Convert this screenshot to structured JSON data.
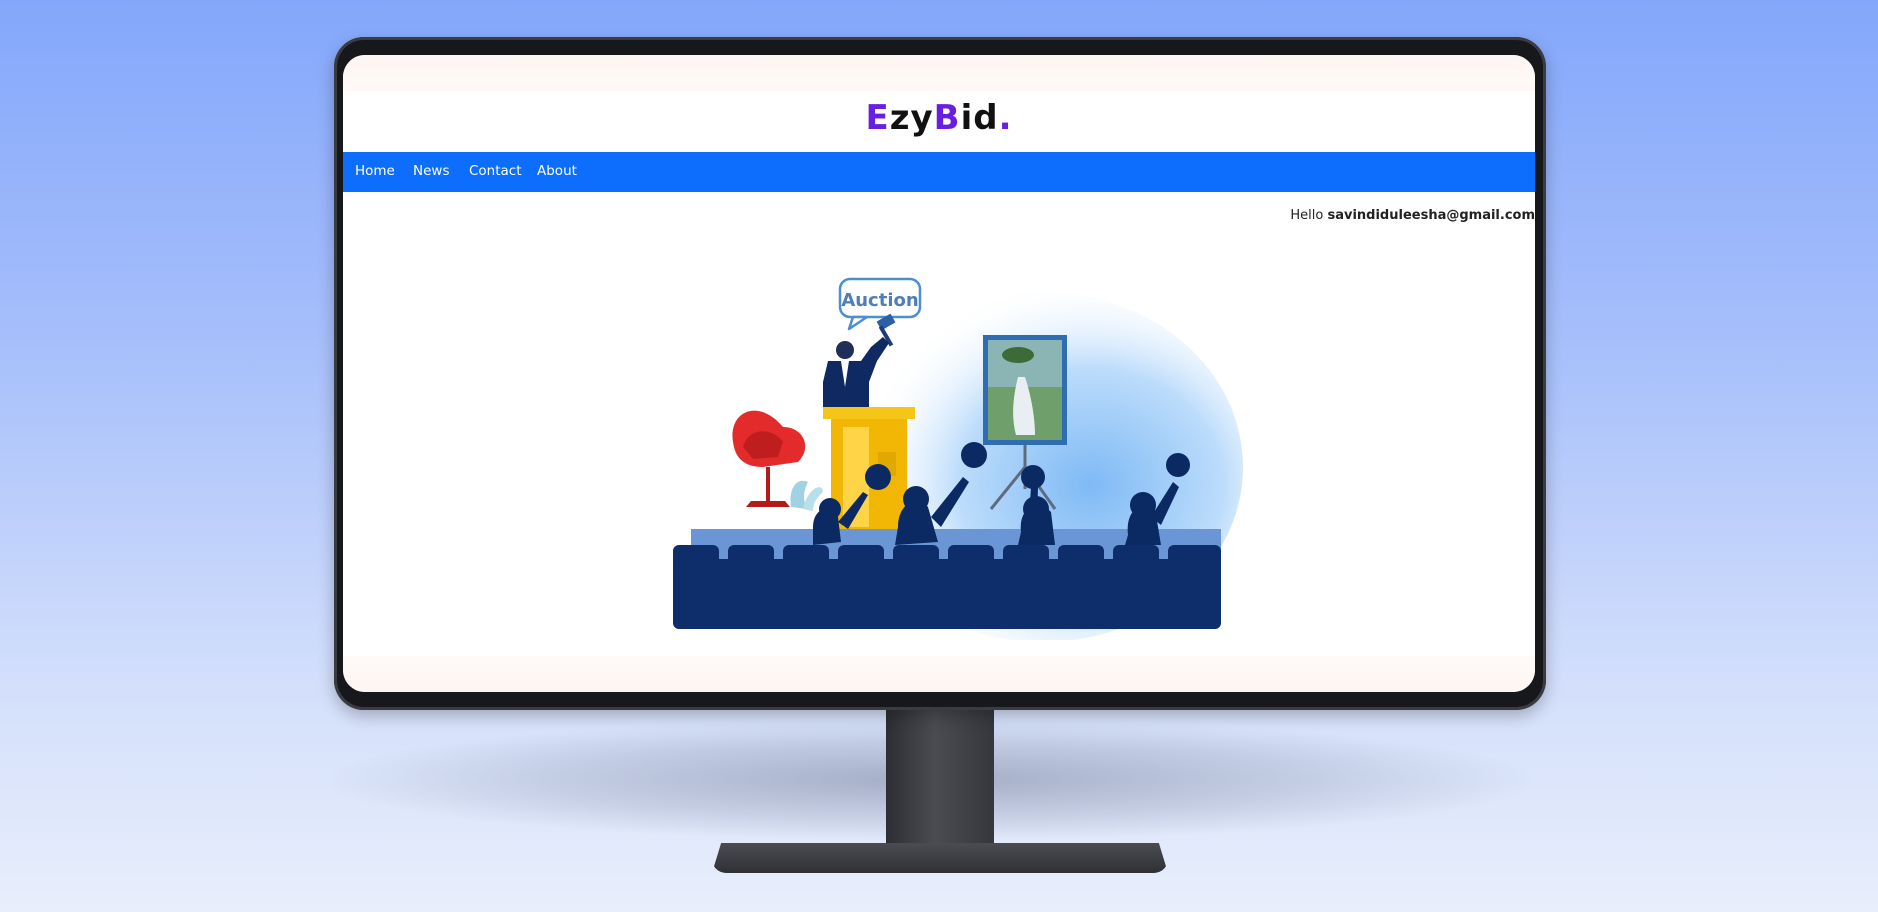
{
  "brand": {
    "logo_e": "E",
    "logo_zy": "zy",
    "logo_b": "B",
    "logo_id": "id",
    "logo_dot": ".",
    "accent_color": "#6a1fe0"
  },
  "nav": {
    "items": [
      {
        "label": "Home"
      },
      {
        "label": "News"
      },
      {
        "label": "Contact"
      },
      {
        "label": "About"
      }
    ],
    "bar_color": "#0d6efd"
  },
  "user": {
    "greeting": "Hello",
    "email": "savindiduleesha@gmail.com"
  },
  "hero": {
    "sign_text": "Auction"
  }
}
